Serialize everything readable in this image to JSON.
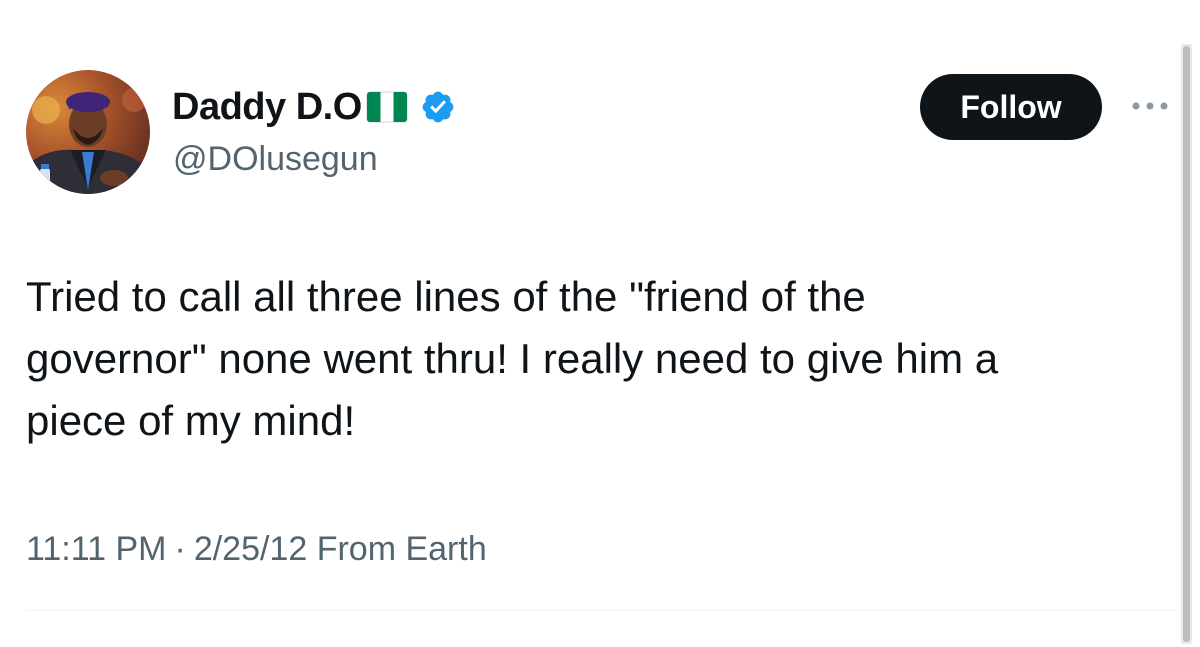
{
  "author": {
    "display_name": "Daddy D.O",
    "handle": "@DOlusegun",
    "flag_icon": "nigeria-flag-icon",
    "verified_icon": "verified-badge-icon",
    "verified_color": "#1d9bf0"
  },
  "actions": {
    "follow_label": "Follow",
    "more_icon": "more-dots-icon"
  },
  "tweet": {
    "text": "Tried to call all three lines of the \"friend of the\ngovernor\" none went thru! I really need to give him a\npiece of my mind!",
    "time": "11:11 PM",
    "separator": "·",
    "date_source": "2/25/12 From Earth"
  },
  "colors": {
    "text_primary": "#0f1419",
    "text_secondary": "#536471",
    "follow_bg": "#0f1419",
    "flag_green": "#008751"
  }
}
